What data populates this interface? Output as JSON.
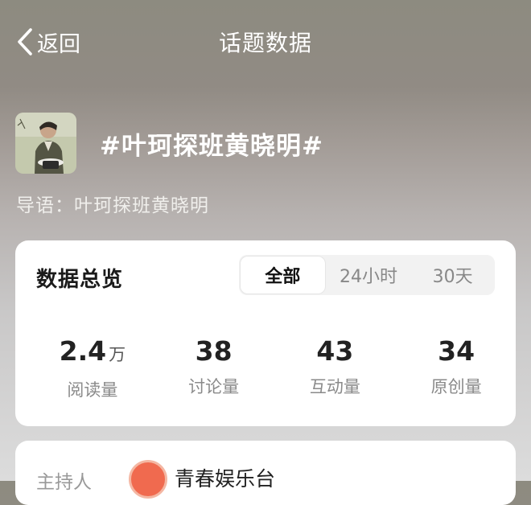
{
  "nav": {
    "back_label": "返回",
    "title": "话题数据"
  },
  "topic": {
    "name": "#叶珂探班黄晓明#",
    "guide": "导语：叶珂探班黄晓明"
  },
  "overview": {
    "title": "数据总览",
    "tabs": [
      {
        "label": "全部",
        "active": true
      },
      {
        "label": "24小时",
        "active": false
      },
      {
        "label": "30天",
        "active": false
      }
    ],
    "stats": [
      {
        "value": "2.4",
        "unit": "万",
        "label": "阅读量"
      },
      {
        "value": "38",
        "unit": "",
        "label": "讨论量"
      },
      {
        "value": "43",
        "unit": "",
        "label": "互动量"
      },
      {
        "value": "34",
        "unit": "",
        "label": "原创量"
      }
    ]
  },
  "host": {
    "label": "主持人",
    "name": "青春娱乐台"
  }
}
